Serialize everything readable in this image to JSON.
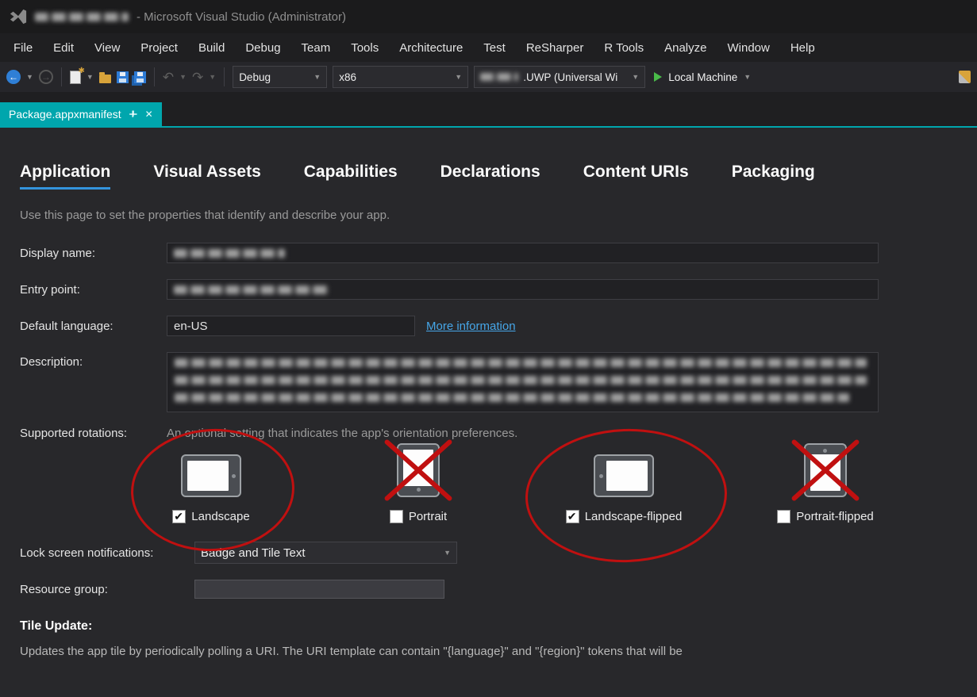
{
  "colors": {
    "tab_teal": "#00a6ad",
    "accent_blue": "#3394dd",
    "link_blue": "#46a6e8",
    "annotation_red": "#c01010"
  },
  "window": {
    "title_suffix": "- Microsoft Visual Studio  (Administrator)"
  },
  "menu": {
    "items": [
      "File",
      "Edit",
      "View",
      "Project",
      "Build",
      "Debug",
      "Team",
      "Tools",
      "Architecture",
      "Test",
      "ReSharper",
      "R Tools",
      "Analyze",
      "Window",
      "Help"
    ]
  },
  "toolbar": {
    "configuration": "Debug",
    "platform": "x86",
    "startup_project_suffix": ".UWP (Universal Wi",
    "run_target": "Local Machine"
  },
  "document_tab": {
    "label": "Package.appxmanifest"
  },
  "manifest_tabs": [
    {
      "label": "Application"
    },
    {
      "label": "Visual Assets"
    },
    {
      "label": "Capabilities"
    },
    {
      "label": "Declarations"
    },
    {
      "label": "Content URIs"
    },
    {
      "label": "Packaging"
    }
  ],
  "page": {
    "intro": "Use this page to set the properties that identify and describe your app.",
    "display_name_label": "Display name:",
    "entry_point_label": "Entry point:",
    "default_language_label": "Default language:",
    "default_language_value": "en-US",
    "more_information_link": "More information",
    "description_label": "Description:",
    "supported_rotations_label": "Supported rotations:",
    "supported_rotations_hint": "An optional setting that indicates the app's orientation preferences.",
    "rotations": [
      {
        "label": "Landscape",
        "checked": true
      },
      {
        "label": "Portrait",
        "checked": false
      },
      {
        "label": "Landscape-flipped",
        "checked": true
      },
      {
        "label": "Portrait-flipped",
        "checked": false
      }
    ],
    "lock_screen_label": "Lock screen notifications:",
    "lock_screen_value": "Badge and Tile Text",
    "resource_group_label": "Resource group:",
    "tile_update_heading": "Tile Update:",
    "tile_update_body": "Updates the app tile by periodically polling a URI. The URI template can contain \"{language}\" and \"{region}\" tokens that will be"
  }
}
